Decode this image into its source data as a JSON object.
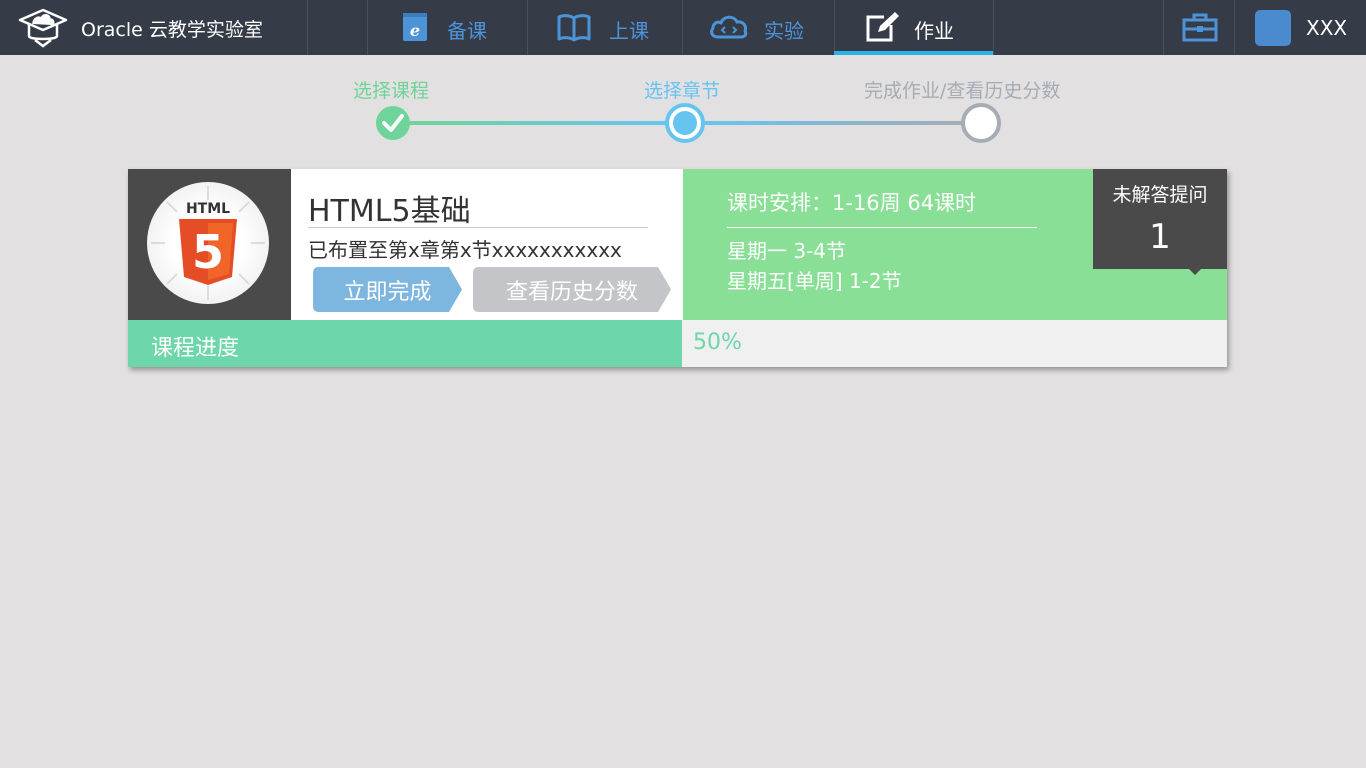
{
  "app": {
    "title": "Oracle 云教学实验室"
  },
  "nav": {
    "items": [
      {
        "label": "备课",
        "icon": "ebook-icon"
      },
      {
        "label": "上课",
        "icon": "open-book-icon"
      },
      {
        "label": "实验",
        "icon": "cloud-code-icon"
      },
      {
        "label": "作业",
        "icon": "edit-icon",
        "active": true
      }
    ],
    "toolbox_icon": "toolbox-icon",
    "user": {
      "name": "XXX"
    }
  },
  "steps": [
    {
      "label": "选择课程",
      "state": "done"
    },
    {
      "label": "选择章节",
      "state": "current"
    },
    {
      "label": "完成作业/查看历史分数",
      "state": "pending"
    }
  ],
  "course": {
    "logo_text": "HTML",
    "logo_number": "5",
    "title": "HTML5基础",
    "assigned_to": "已布置至第x章第x节xxxxxxxxxxx",
    "finish_button": "立即完成",
    "history_button": "查看历史分数",
    "schedule_title": "课时安排：1-16周 64课时",
    "schedule_lines": [
      "星期一 3-4节",
      "星期五[单周] 1-2节"
    ],
    "unanswered_label": "未解答提问",
    "unanswered_count": "1",
    "progress_label": "课程进度",
    "progress_value": "50%",
    "progress_fraction": 0.5
  },
  "colors": {
    "topbar": "#363b48",
    "step_done": "#6fd49a",
    "step_current": "#66c4f1",
    "step_pending": "#a5acb5",
    "schedule_bg": "#89df95",
    "progress_fill": "#6dd6aa",
    "button_finish": "#7db7e0",
    "button_history": "#c3c5c8"
  }
}
